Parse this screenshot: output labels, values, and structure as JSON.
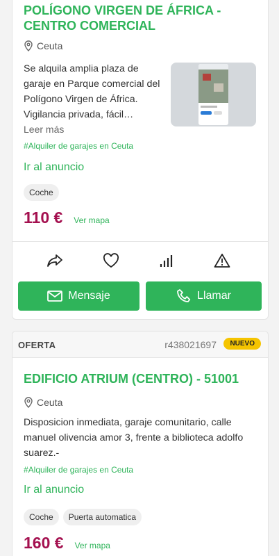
{
  "listing1": {
    "title": "POLÍGONO VIRGEN DE ÁFRICA - CENTRO COMERCIAL",
    "location": "Ceuta",
    "description": "Se alquila amplia plaza de garaje en Parque comercial del Polígono Virgen de África. Vigilancia privada, fácil…",
    "more_label": "Leer más",
    "tag": "#Alquiler de garajes en Ceuta",
    "link_label": "Ir al anuncio",
    "chips": [
      "Coche"
    ],
    "price": "110 €",
    "map_label": "Ver mapa",
    "message_label": "Mensaje",
    "call_label": "Llamar"
  },
  "listing2": {
    "section_label": "OFERTA",
    "reference": "r438021697",
    "badge": "NUEVO",
    "title": "EDIFICIO ATRIUM (CENTRO) - 51001",
    "location": "Ceuta",
    "description": "Disposicion inmediata, garaje comunitario, calle manuel olivencia amor 3, frente a biblioteca adolfo suarez.-",
    "tag": "#Alquiler de garajes en Ceuta",
    "link_label": "Ir al anuncio",
    "chips": [
      "Coche",
      "Puerta automatica"
    ],
    "price": "160 €",
    "map_label": "Ver mapa"
  },
  "icons": {
    "location": "location-pin-icon",
    "share": "share-icon",
    "favorite": "heart-icon",
    "stats": "bar-chart-icon",
    "report": "warning-icon",
    "message": "mail-icon",
    "call": "phone-icon"
  },
  "colors": {
    "brand_green": "#2fb45a",
    "price": "#a4104f",
    "badge": "#f5c400"
  }
}
